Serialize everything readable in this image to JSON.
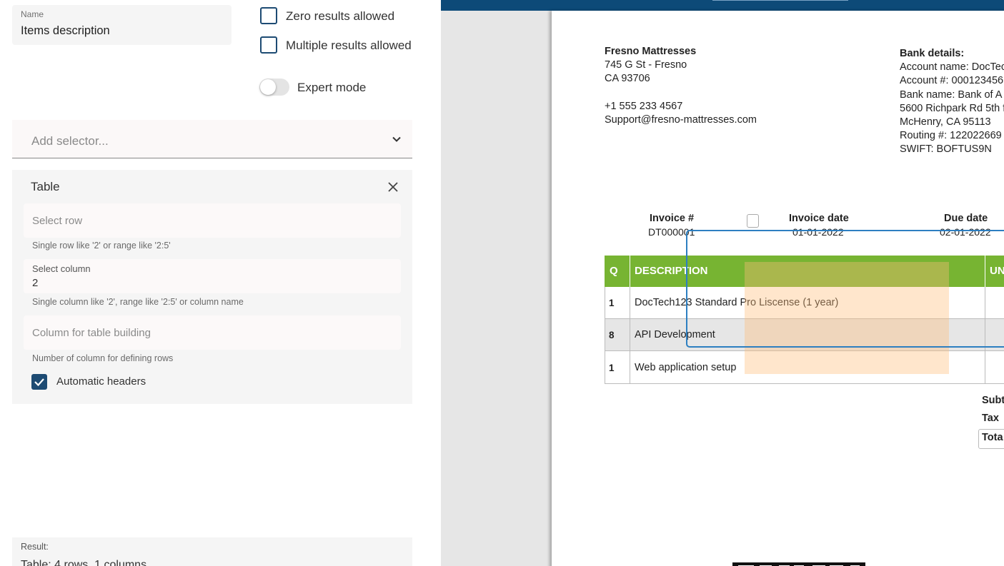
{
  "config": {
    "name_label": "Name",
    "name_value": "Items description",
    "zero_results_label": "Zero results allowed",
    "multiple_results_label": "Multiple results allowed",
    "expert_mode_label": "Expert mode",
    "add_selector_placeholder": "Add selector...",
    "table": {
      "title": "Table",
      "select_row_placeholder": "Select row",
      "select_row_hint": "Single row like '2' or range like '2:5'",
      "select_column_label": "Select column",
      "select_column_value": "2",
      "select_column_hint": "Single column like '2', range like '2:5' or column name",
      "column_building_placeholder": "Column for table building",
      "column_building_hint": "Number of column for defining rows",
      "automatic_headers_label": "Automatic headers",
      "automatic_headers_checked": true
    },
    "result_label": "Result:",
    "result_value": "Table: 4 rows, 1 columns"
  },
  "document": {
    "company_name": "Fresno Mattresses",
    "address_line1": "745 G St - Fresno",
    "address_line2": "CA 93706",
    "phone": "+1 555 233 4567",
    "email": "Support@fresno-mattresses.com",
    "bank_title": "Bank details:",
    "bank_lines": [
      "Account name: DocTec",
      "Account #: 000123456",
      "Bank name: Bank of A",
      "5600 Richpark Rd 5th f",
      "McHenry, CA 95113",
      "Routing #: 122022669",
      "SWIFT: BOFTUS9N"
    ],
    "invoice_no_label": "Invoice #",
    "invoice_no": "DT000001",
    "invoice_date_label": "Invoice date",
    "invoice_date": "01-01-2022",
    "due_date_label": "Due date",
    "due_date": "02-01-2022",
    "table_headers": [
      "Q",
      "DESCRIPTION",
      "UN"
    ],
    "rows": [
      {
        "q": "1",
        "description": "DocTech123 Standard Pro Liscense (1 year)"
      },
      {
        "q": "8",
        "description": "API Development"
      },
      {
        "q": "1",
        "description": "Web application setup"
      }
    ],
    "subtotal_label": "Subt",
    "tax_label": "Tax",
    "total_label": "Tota"
  },
  "colors": {
    "accent_dark": "#1d4b73",
    "viewer_bar": "#0d4a78",
    "table_header_green": "#77b432",
    "selection_blue": "#2d7fc1",
    "highlight_orange": "#ffbe78"
  }
}
